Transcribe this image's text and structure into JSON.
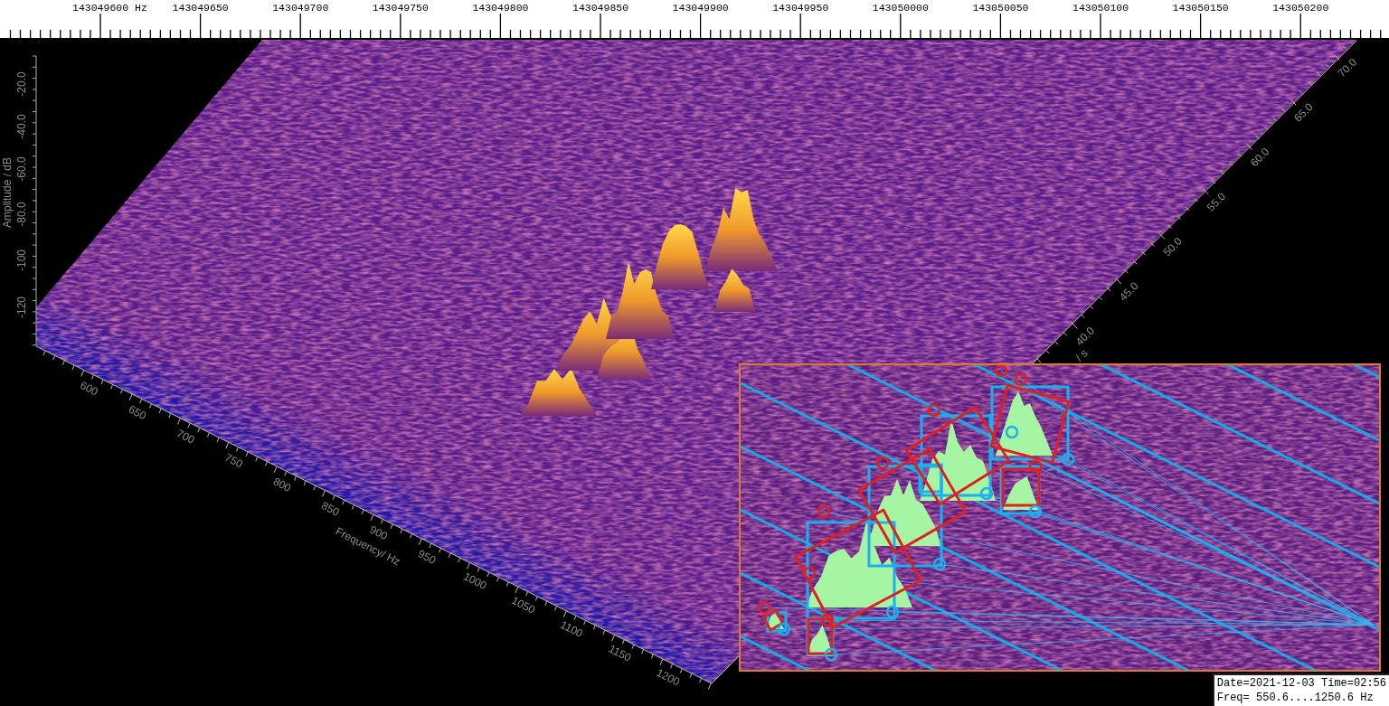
{
  "ruler": {
    "labels": [
      "143049600 Hz",
      "143049650",
      "143049700",
      "143049750",
      "143049800",
      "143049850",
      "143049900",
      "143049950",
      "143050000",
      "143050050",
      "143050100",
      "143050150",
      "143050200"
    ]
  },
  "plot": {
    "amplitude_axis": {
      "title": "Amplitude / dB",
      "ticks": [
        "-20.0",
        "-40.0",
        "-60.0",
        "-80.0",
        "-100",
        "-120"
      ]
    },
    "frequency_axis": {
      "title": "Frequency/ Hz",
      "ticks": [
        "600",
        "650",
        "700",
        "750",
        "800",
        "850",
        "900",
        "950",
        "1000",
        "1050",
        "1100",
        "1150",
        "1200"
      ]
    },
    "time_axis": {
      "title": "/ s",
      "ticks": [
        "40.0",
        "45.0",
        "50.0",
        "55.0",
        "60.0",
        "65.0",
        "70.0"
      ]
    }
  },
  "info": {
    "lines": [
      "Date=2021-12-03 Time=02:56",
      "Freq= 550.6....1250.6 Hz"
    ]
  }
}
